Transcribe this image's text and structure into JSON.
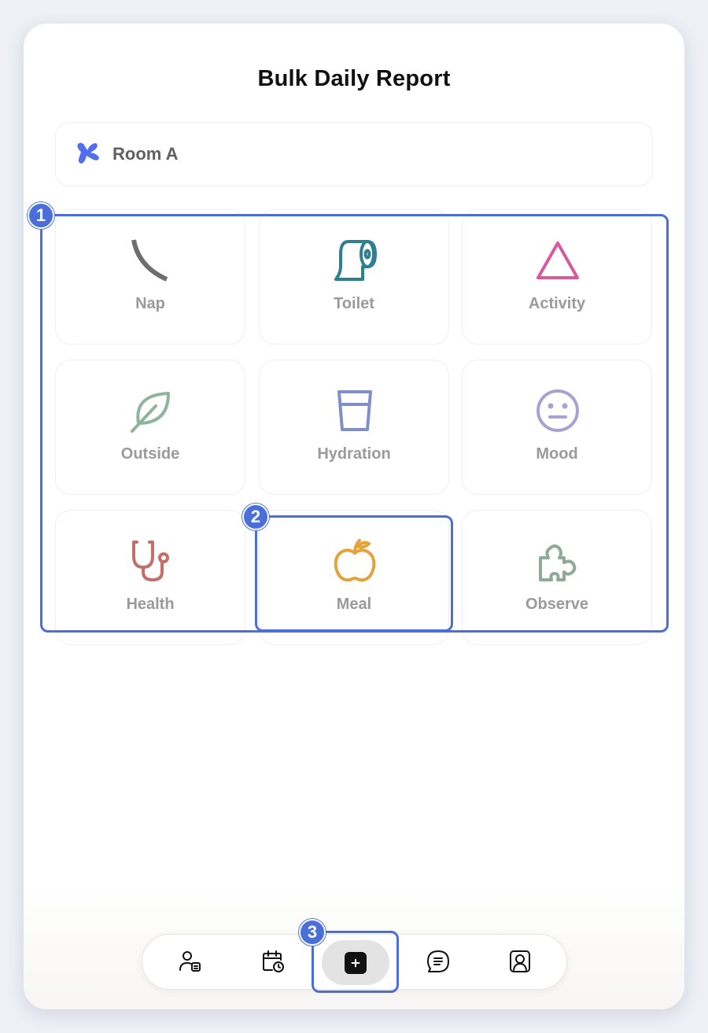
{
  "page": {
    "title": "Bulk Daily Report"
  },
  "room": {
    "name": "Room A",
    "accent": "#4f6ff0"
  },
  "activities": [
    {
      "key": "nap",
      "label": "Nap",
      "icon": "moon-icon",
      "color": "#6e6e6e"
    },
    {
      "key": "toilet",
      "label": "Toilet",
      "icon": "toilet-paper-icon",
      "color": "#2f7f93"
    },
    {
      "key": "activity",
      "label": "Activity",
      "icon": "triangle-icon",
      "color": "#d65a9c"
    },
    {
      "key": "outside",
      "label": "Outside",
      "icon": "leaf-icon",
      "color": "#8fb49c"
    },
    {
      "key": "hydration",
      "label": "Hydration",
      "icon": "glass-icon",
      "color": "#7f8fc8"
    },
    {
      "key": "mood",
      "label": "Mood",
      "icon": "neutral-face-icon",
      "color": "#a7a2d2"
    },
    {
      "key": "health",
      "label": "Health",
      "icon": "stethoscope-icon",
      "color": "#c46f6a"
    },
    {
      "key": "meal",
      "label": "Meal",
      "icon": "apple-icon",
      "color": "#e3a23c"
    },
    {
      "key": "observe",
      "label": "Observe",
      "icon": "puzzle-icon",
      "color": "#8fa99a"
    }
  ],
  "annotations": {
    "grid": "1",
    "meal": "2",
    "add": "3",
    "color": "#4a6fd8"
  },
  "nav": [
    {
      "icon": "child-profile-icon"
    },
    {
      "icon": "calendar-clock-icon"
    },
    {
      "icon": "add-icon"
    },
    {
      "icon": "message-icon"
    },
    {
      "icon": "portrait-icon"
    }
  ]
}
